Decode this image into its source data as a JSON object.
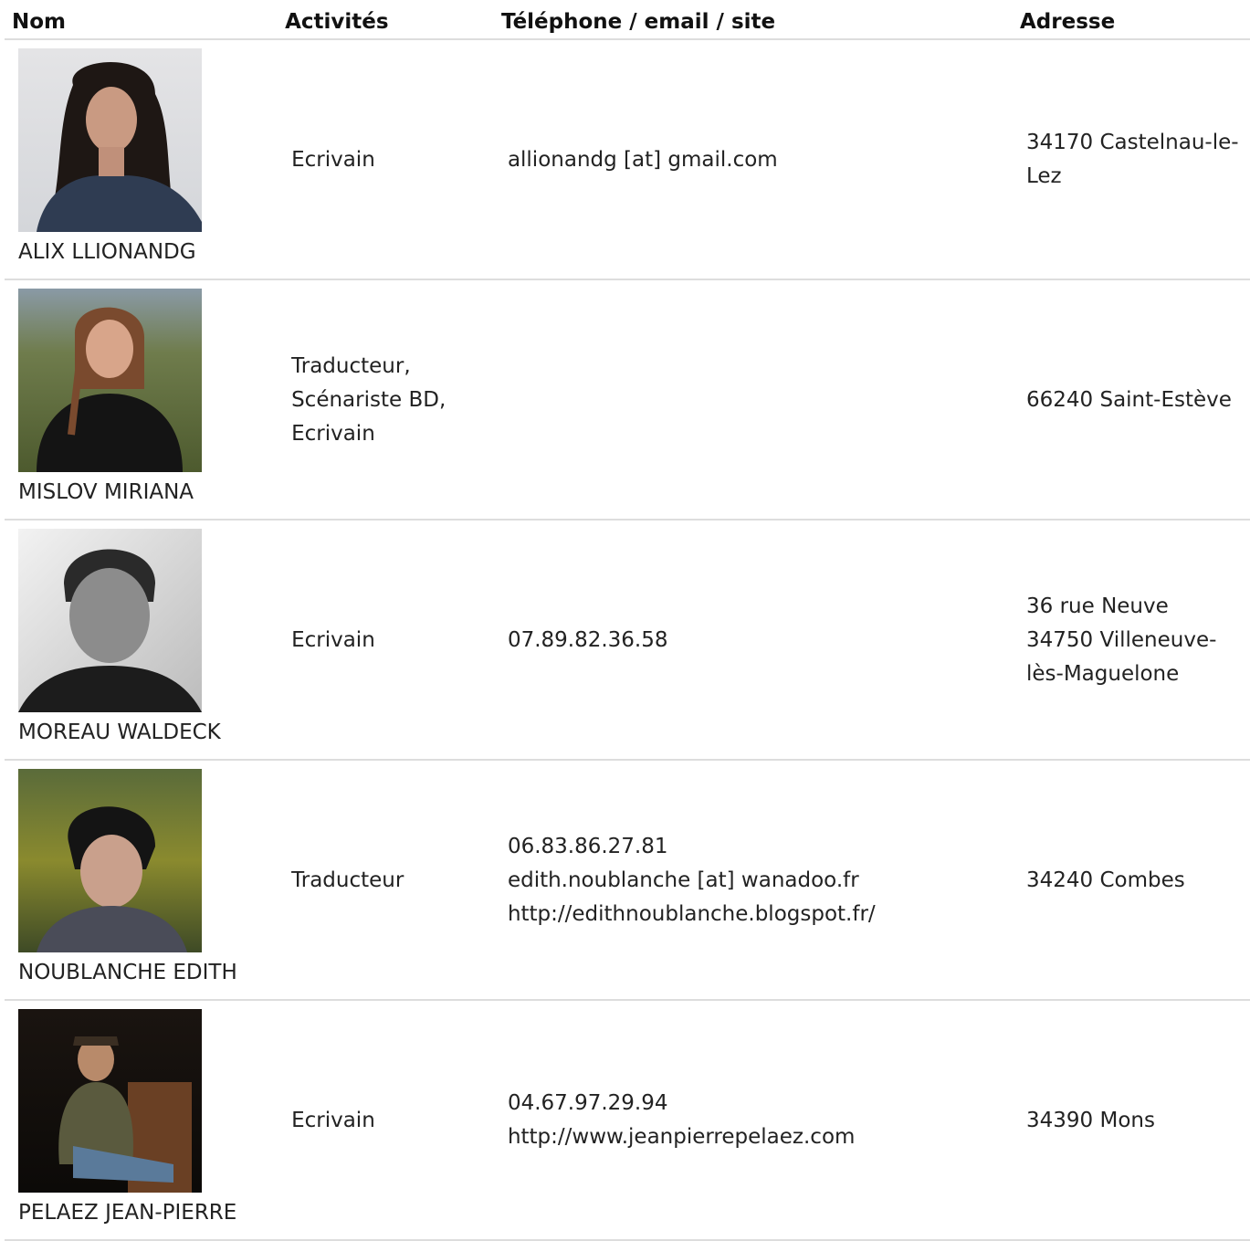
{
  "table": {
    "headers": {
      "name": "Nom",
      "activities": "Activités",
      "contact": "Téléphone / email / site",
      "address": "Adresse"
    },
    "rows": [
      {
        "name": "ALIX LLIONANDG",
        "photo": "portrait-curly-hair-denim-shirt",
        "activities": [
          "Ecrivain"
        ],
        "contact": [
          "allionandg [at] gmail.com"
        ],
        "address": [
          "34170 Castelnau-le-Lez"
        ]
      },
      {
        "name": "MISLOV MIRIANA",
        "photo": "portrait-braid-outdoors",
        "activities": [
          "Traducteur,",
          "Scénariste BD,",
          "Ecrivain"
        ],
        "contact": [],
        "address": [
          "66240 Saint-Estève"
        ]
      },
      {
        "name": "MOREAU WALDECK",
        "photo": "portrait-black-and-white",
        "activities": [
          "Ecrivain"
        ],
        "contact": [
          "07.89.82.36.58"
        ],
        "address": [
          "36 rue Neuve",
          "34750 Villeneuve-lès-Maguelone"
        ]
      },
      {
        "name": "NOUBLANCHE EDITH",
        "photo": "portrait-scarf-garden",
        "activities": [
          "Traducteur"
        ],
        "contact": [
          "06.83.86.27.81",
          "edith.noublanche [at] wanadoo.fr",
          "http://edithnoublanche.blogspot.fr/"
        ],
        "address": [
          "34240 Combes"
        ]
      },
      {
        "name": "PELAEZ JEAN-PIERRE",
        "photo": "portrait-seated-stage",
        "activities": [
          "Ecrivain"
        ],
        "contact": [
          "04.67.97.29.94",
          "http://www.jeanpierrepelaez.com"
        ],
        "address": [
          "34390 Mons"
        ]
      }
    ]
  }
}
